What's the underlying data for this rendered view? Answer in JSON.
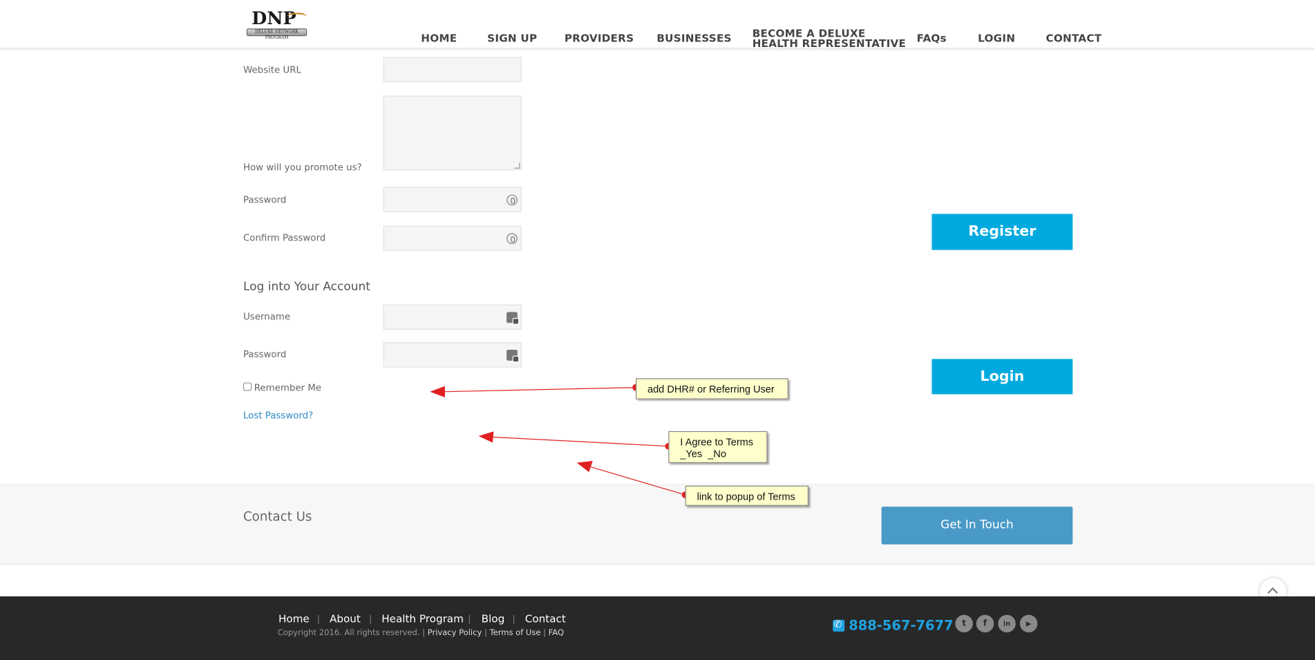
{
  "header": {
    "logo_text": "DNP",
    "logo_subtext": "DELUXE NETWORK PROGRAM",
    "nav": [
      {
        "label": "HOME"
      },
      {
        "label": "SIGN UP"
      },
      {
        "label": "PROVIDERS"
      },
      {
        "label": "BUSINESSES"
      },
      {
        "label_line1": "BECOME A DELUXE",
        "label_line2": "HEALTH REPRESENTATIVE"
      },
      {
        "label": "FAQs"
      },
      {
        "label": "LOGIN"
      },
      {
        "label": "CONTACT"
      }
    ]
  },
  "register_form": {
    "website_label": "Website URL",
    "promote_label": "How will you promote us?",
    "password_label": "Password",
    "confirm_label": "Confirm Password",
    "button": "Register"
  },
  "login_form": {
    "title": "Log into Your Account",
    "username_label": "Username",
    "password_label": "Password",
    "remember_label": "Remember Me",
    "lost_password": "Lost Password?",
    "button": "Login"
  },
  "annotations": [
    {
      "text": "add DHR# or Referring User"
    },
    {
      "text": "I Agree to Terms\n_Yes  _No"
    },
    {
      "text": "link to popup of Terms"
    }
  ],
  "contact": {
    "title": "Contact Us",
    "button": "Get In Touch"
  },
  "footer": {
    "links": [
      "Home",
      "About",
      "Health Program",
      "Blog",
      "Contact"
    ],
    "separator": "|",
    "copyright": "Copyright 2016. All rights reserved. |",
    "legal_links": [
      "Privacy Policy",
      "Terms of Use",
      "FAQ"
    ],
    "legal_separator": "|",
    "phone": "888-567-7677",
    "social": [
      {
        "icon": "twitter-icon",
        "glyph": "t"
      },
      {
        "icon": "facebook-icon",
        "glyph": "f"
      },
      {
        "icon": "linkedin-icon",
        "glyph": "in"
      },
      {
        "icon": "youtube-icon",
        "glyph": "▶"
      }
    ]
  },
  "colors": {
    "accent": "#00aadf",
    "touch_button": "#4a9ac7",
    "footer_bg": "#282828",
    "annotation_arrow": "#e02020",
    "annotation_note": "#ffffcc"
  }
}
